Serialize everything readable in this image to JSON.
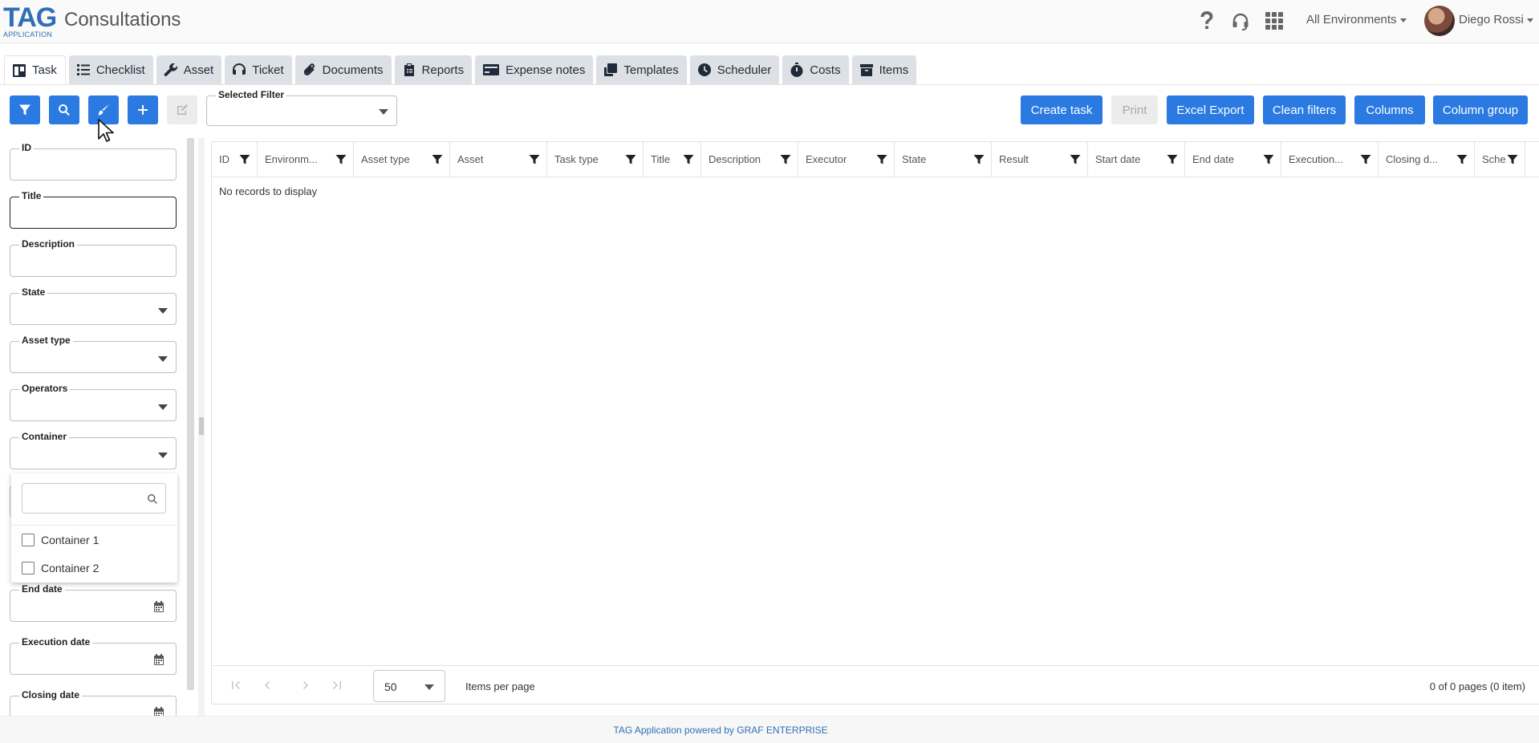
{
  "header": {
    "logo_text": "TAG",
    "logo_sub": "APPLICATION",
    "title": "Consultations",
    "environment": "All Environments",
    "user_name": "Diego Rossi",
    "icons": [
      "help-icon",
      "headset-icon",
      "apps-grid-icon"
    ]
  },
  "tabs": [
    {
      "label": "Task",
      "icon": "board-icon",
      "active": true
    },
    {
      "label": "Checklist",
      "icon": "list-icon"
    },
    {
      "label": "Asset",
      "icon": "wrench-icon"
    },
    {
      "label": "Ticket",
      "icon": "headset-icon"
    },
    {
      "label": "Documents",
      "icon": "paperclip-icon"
    },
    {
      "label": "Reports",
      "icon": "clipboard-icon"
    },
    {
      "label": "Expense notes",
      "icon": "credit-card-icon"
    },
    {
      "label": "Templates",
      "icon": "copy-icon"
    },
    {
      "label": "Scheduler",
      "icon": "clock-icon"
    },
    {
      "label": "Costs",
      "icon": "stopwatch-icon"
    },
    {
      "label": "Items",
      "icon": "box-icon"
    }
  ],
  "toolbar": {
    "icon_buttons": [
      "filter-icon",
      "search-icon",
      "brush-icon",
      "plus-icon",
      "edit-icon"
    ],
    "selected_filter_label": "Selected Filter",
    "selected_filter_value": "",
    "actions": {
      "create": "Create task",
      "print": "Print",
      "excel": "Excel Export",
      "clean": "Clean filters",
      "columns": "Columns",
      "column_group": "Column group"
    }
  },
  "filters": {
    "id": "ID",
    "title": "Title",
    "description": "Description",
    "state": "State",
    "asset_type": "Asset type",
    "operators": "Operators",
    "container": "Container",
    "end_date": "End date",
    "execution_date": "Execution date",
    "closing_date": "Closing date",
    "container_options": [
      "Container 1",
      "Container 2"
    ],
    "container_search": ""
  },
  "grid": {
    "columns": [
      "ID",
      "Environm...",
      "Asset type",
      "Asset",
      "Task type",
      "Title",
      "Description",
      "Executor",
      "State",
      "Result",
      "Start date",
      "End date",
      "Execution...",
      "Closing d...",
      "Sche"
    ],
    "empty_message": "No records to display",
    "page_size": "50",
    "items_per_page": "Items per page",
    "page_info": "0 of 0 pages (0 item)"
  },
  "footer": {
    "text": "TAG Application powered by GRAF ENTERPRISE"
  },
  "colors": {
    "primary": "#2a7ae2",
    "brand": "#2f6fb5"
  }
}
